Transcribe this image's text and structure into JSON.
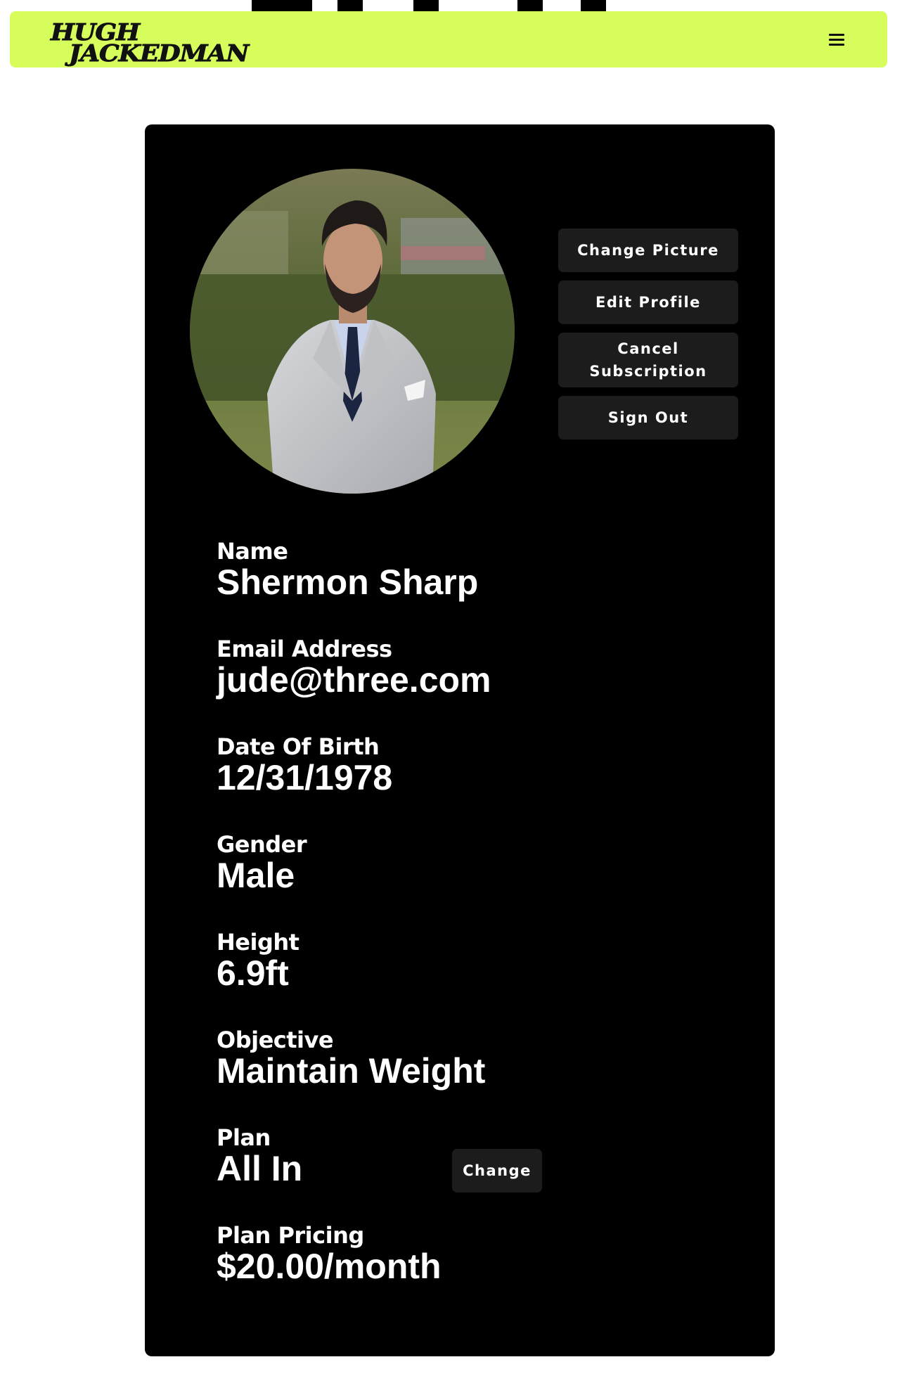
{
  "header": {
    "logo_line1": "HUGH",
    "logo_line2": "JACKEDMAN",
    "menu_icon": "hamburger-menu-icon"
  },
  "profile": {
    "actions": {
      "change_picture": "Change Picture",
      "edit_profile": "Edit Profile",
      "cancel_subscription": "Cancel Subscription",
      "sign_out": "Sign Out"
    },
    "fields": {
      "name_label": "Name",
      "name_value": "Shermon Sharp",
      "email_label": "Email Address",
      "email_value": "jude@three.com",
      "dob_label": "Date Of Birth",
      "dob_value": "12/31/1978",
      "gender_label": "Gender",
      "gender_value": "Male",
      "height_label": "Height",
      "height_value": "6.9ft",
      "objective_label": "Objective",
      "objective_value": "Maintain Weight",
      "plan_label": "Plan",
      "plan_value": "All In",
      "plan_change": "Change",
      "pricing_label": "Plan Pricing",
      "pricing_value": "$20.00/month"
    }
  },
  "colors": {
    "accent": "#d7fd5c",
    "card": "#000000",
    "button": "#1c1c1c"
  }
}
